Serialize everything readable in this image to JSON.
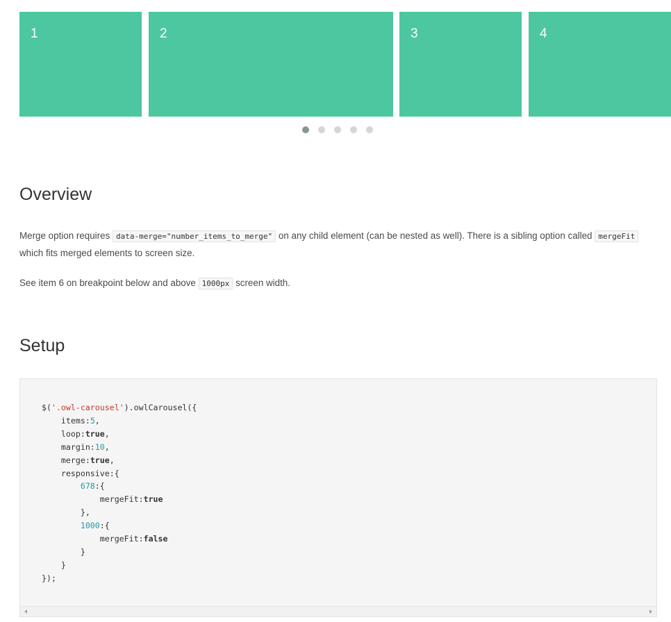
{
  "carousel": {
    "items": [
      {
        "label": "1"
      },
      {
        "label": "2"
      },
      {
        "label": "3"
      },
      {
        "label": "4"
      }
    ],
    "dots_total": 5,
    "active_dot": 1,
    "slide_color": "#4dc7a0"
  },
  "overview": {
    "heading": "Overview",
    "p1_a": "Merge option requires",
    "p1_code1": "data-merge=\"number_items_to_merge\"",
    "p1_b": "on any child element (can be nested as well). There is a sibling option called",
    "p1_code2": "mergeFit",
    "p1_c": "which fits merged elements to screen size.",
    "p2_a": "See item 6 on breakpoint below and above",
    "p2_code": "1000px",
    "p2_b": "screen width."
  },
  "setup": {
    "heading": "Setup",
    "code": {
      "line1_a": "$(",
      "line1_str": "'.owl-carousel'",
      "line1_b": ").owlCarousel({",
      "items_key": "    items:",
      "items_val": "5",
      "loop_key": "    loop:",
      "loop_val": "true",
      "margin_key": "    margin:",
      "margin_val": "10",
      "merge_key": "    merge:",
      "merge_val": "true",
      "responsive_key": "    responsive:{",
      "bp1": "678",
      "bp1_open": ":{",
      "mergefit1_key": "            mergeFit:",
      "mergefit1_val": "true",
      "bp1_close": "        },",
      "bp2": "1000",
      "bp2_open": ":{",
      "mergefit2_key": "            mergeFit:",
      "mergefit2_val": "false",
      "bp2_close": "        }",
      "resp_close": "    }",
      "end": "});"
    }
  }
}
